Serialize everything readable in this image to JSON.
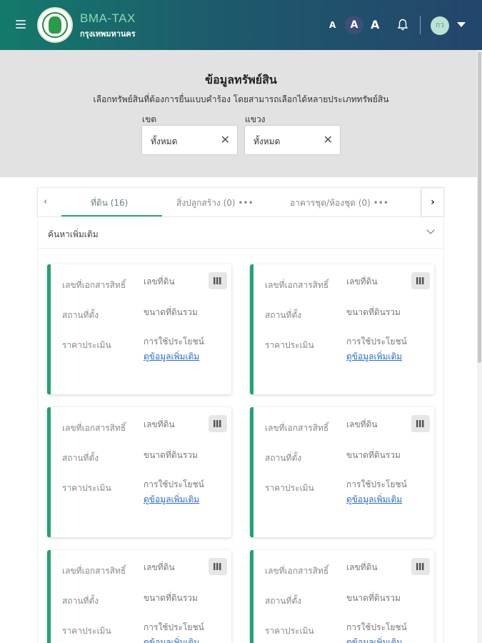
{
  "header": {
    "brand_title": "BMA-TAX",
    "brand_subtitle": "กรุงเทพมหานคร",
    "font_size_small": "A",
    "font_size_medium": "A",
    "font_size_large": "A",
    "avatar_initials": "กว",
    "icons": [
      "menu-icon",
      "bma-logo",
      "bell-icon",
      "chevron-down-icon"
    ]
  },
  "filter": {
    "title": "ข้อมูลทรัพย์สิน",
    "description": "เลือกทรัพย์สินที่ต้องการยื่นแบบคำร้อง โดยสามารถเลือกได้หลายประเภททรัพย์สิน",
    "district_label": "เขต",
    "district_value": "ทั้งหมด",
    "subdistrict_label": "แขวง",
    "subdistrict_value": "ทั้งหมด"
  },
  "tabs": {
    "prev": "‹",
    "next": "›",
    "items": [
      {
        "label": "ที่ดิน (16)",
        "active": true
      },
      {
        "label": "สิ่งปลูกสร้าง (0) •••",
        "active": false
      },
      {
        "label": "อาคารชุด/ห้องชุด (0) •••",
        "active": false
      }
    ]
  },
  "more_search": {
    "label": "ค้นหาเพิ่มเติม"
  },
  "card_labels": {
    "deed_no": "เลขที่เอกสารสิทธิ์",
    "land_no": "เลขที่ดิน",
    "location": "สถานที่ตั้ง",
    "total_area": "ขนาดที่ดินรวม",
    "appraisal": "ราคาประเมิน",
    "usage": "การใช้ประโยชน์",
    "more_info": "ดูข้อมูลเพิ่มเติม"
  },
  "colors": {
    "accent": "#20a276",
    "link": "#2a6ad8",
    "panel_bg": "#e2e2e2"
  }
}
